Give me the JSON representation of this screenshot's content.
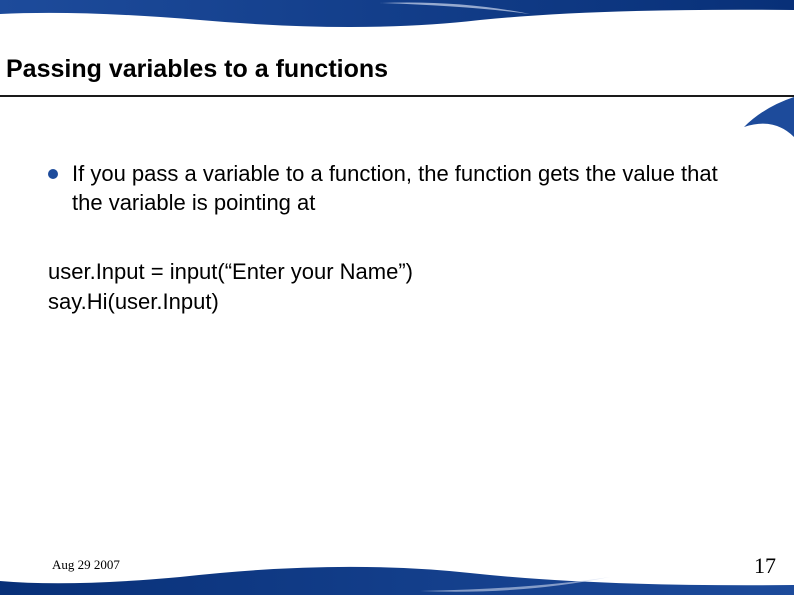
{
  "title": "Passing variables to a functions",
  "bullet_text": "If you pass a variable to a function, the function gets the value that the variable is pointing at",
  "code": {
    "line1": "user.Input = input(“Enter your Name”)",
    "line2": "say.Hi(user.Input)"
  },
  "footer_date": "Aug 29 2007",
  "page_number": "17",
  "colors": {
    "accent": "#1d4b9b"
  }
}
